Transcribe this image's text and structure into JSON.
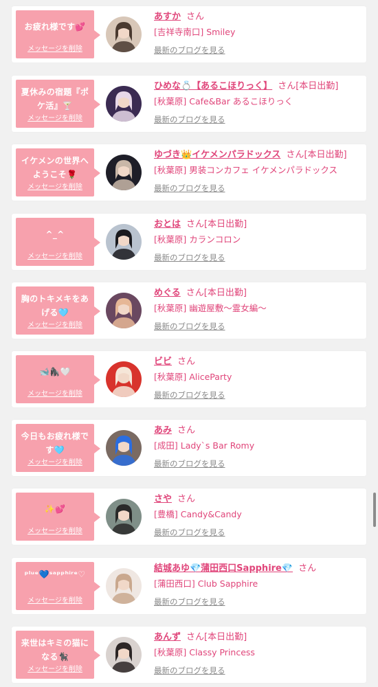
{
  "list": {
    "delete_label": "メッセージを削除",
    "blog_label": "最新のブログを見る",
    "honorific": "さん",
    "working_today": "[本日出勤]",
    "items": [
      {
        "message": "お疲れ様です💕",
        "name": "あすか",
        "status": "",
        "shop": "[吉祥寺南口] Smiley",
        "avatar_colors": [
          "#d8c7b8",
          "#4a3a30"
        ]
      },
      {
        "message": "夏休みの宿題『ポケ活』🍸",
        "name": "ひめな💍【あるこほりっく】",
        "status": "[本日出勤]",
        "shop": "[秋葉原] Cafe&Bar あるこほりっく",
        "avatar_colors": [
          "#3b2b52",
          "#e8d8e8"
        ]
      },
      {
        "message": "イケメンの世界へようこそ🌹",
        "name": "ゆづき👑イケメンパラドックス",
        "status": "[本日出勤]",
        "shop": "[秋葉原] 男装コンカフェ イケメンパラドックス",
        "avatar_colors": [
          "#1e1e28",
          "#c9b7a8"
        ]
      },
      {
        "message": "^_^",
        "name": "おとは",
        "status": "[本日出勤]",
        "shop": "[秋葉原] カランコロン",
        "avatar_colors": [
          "#b9c3cf",
          "#1a1a1e"
        ]
      },
      {
        "message": "胸のトキメキをあげる🩵",
        "name": "めぐる",
        "status": "[本日出勤]",
        "shop": "[秋葉原] 幽遊屋敷〜霊女編〜",
        "avatar_colors": [
          "#6a4860",
          "#e6b796"
        ]
      },
      {
        "message": "🐋🦍🤍",
        "name": "ビビ",
        "status": "",
        "shop": "[秋葉原] AliceParty",
        "avatar_colors": [
          "#d8332c",
          "#f5e6d8"
        ]
      },
      {
        "message": "今日もお疲れ様です🩵",
        "name": "あみ",
        "status": "",
        "shop": "[成田] Lady`s Bar Romy",
        "avatar_colors": [
          "#7a6a62",
          "#2b6de0"
        ]
      },
      {
        "message": "✨💕",
        "name": "さや",
        "status": "",
        "shop": "[豊橋] Candy&Candy",
        "avatar_colors": [
          "#7f8f88",
          "#2a2a2a"
        ]
      },
      {
        "message": "ᵖˡᵘᵉ💙ˢᵃᵖᵖʰⁱʳᵉ♡",
        "name": "結城あゆ💎蒲田西口Sapphire💎",
        "status": "",
        "shop": "[蒲田西口] Club Sapphire",
        "avatar_colors": [
          "#efe7e2",
          "#c9a88e"
        ]
      },
      {
        "message": "来世はキミの猫になる🐈‍⬛",
        "name": "あんず",
        "status": "[本日出勤]",
        "shop": "[秋葉原] Classy Princess",
        "avatar_colors": [
          "#d9d2cf",
          "#2c2626"
        ]
      }
    ]
  }
}
